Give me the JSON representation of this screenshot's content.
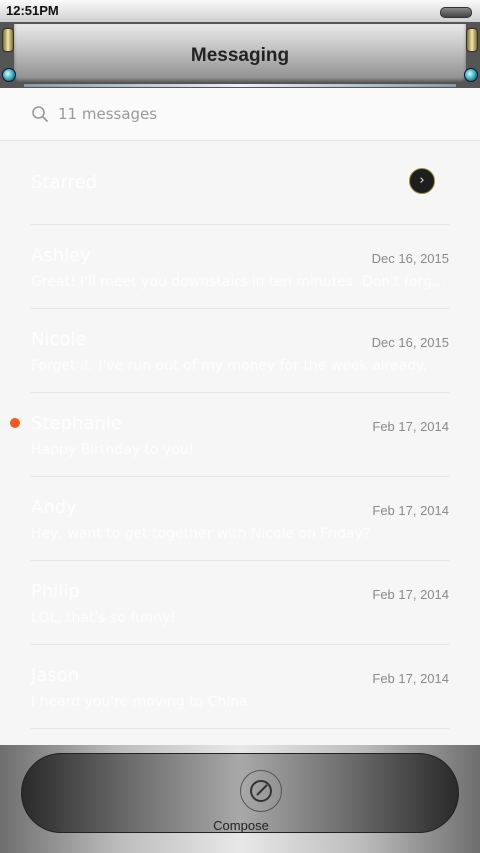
{
  "status_bar": {
    "time": "12:51PM"
  },
  "header": {
    "title": "Messaging"
  },
  "search": {
    "count_text": "11 messages"
  },
  "starred": {
    "label": "Starred"
  },
  "messages": [
    {
      "name": "Ashley",
      "date": "Dec 16, 2015",
      "preview": "Great! I'll meet you downstairs in ten minutes. Don't forge...",
      "unread": false
    },
    {
      "name": "Nicole",
      "date": "Dec 16, 2015",
      "preview": "Forget it. I've run out of my money for the week already.",
      "unread": false
    },
    {
      "name": "Stephanie",
      "date": "Feb 17, 2014",
      "preview": "Happy Birthday to you!",
      "unread": true
    },
    {
      "name": "Andy",
      "date": "Feb 17, 2014",
      "preview": "Hey, want to get together with Nicole on Friday?",
      "unread": false
    },
    {
      "name": "Philip",
      "date": "Feb 17, 2014",
      "preview": "LOL, that's so funny!",
      "unread": false
    },
    {
      "name": "Jason",
      "date": "Feb 17, 2014",
      "preview": "I heard you're moving to China",
      "unread": false
    }
  ],
  "bottom_bar": {
    "compose_label": "Compose"
  },
  "colors": {
    "unread_dot": "#f05a1e",
    "accent_ring": "#9a8a3a"
  }
}
